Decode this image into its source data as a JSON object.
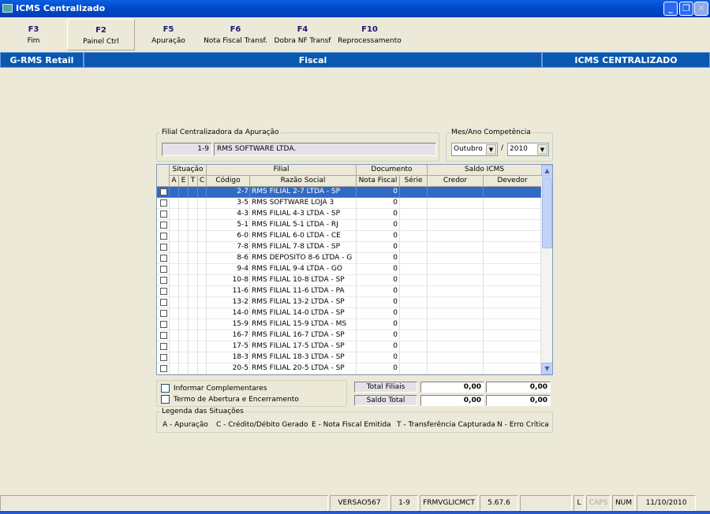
{
  "window": {
    "title": "ICMS Centralizado",
    "minimize": "_",
    "restore": "❐",
    "close": "✕"
  },
  "toolbar": [
    {
      "key": "F3",
      "label": "Fim"
    },
    {
      "key": "F2",
      "label": "Painel Ctrl"
    },
    {
      "key": "F5",
      "label": "Apuração"
    },
    {
      "key": "F6",
      "label": "Nota Fiscal Transf."
    },
    {
      "key": "F4",
      "label": "Dobra NF Transf"
    },
    {
      "key": "F10",
      "label": "Reprocessamento"
    }
  ],
  "header": {
    "left": "G-RMS Retail",
    "center": "Fiscal",
    "right": "ICMS CENTRALIZADO"
  },
  "filial": {
    "legend": "Filial Centralizadora da Apuração",
    "code": "1-9",
    "name": "RMS SOFTWARE LTDA."
  },
  "competencia": {
    "legend": "Mes/Ano Competência",
    "month": "Outubro",
    "sep": "/",
    "year": "2010"
  },
  "grid": {
    "groups": {
      "situacao": "Situação",
      "filial": "Filial",
      "documento": "Documento",
      "saldo": "Saldo ICMS"
    },
    "columns": {
      "a": "A",
      "e": "E",
      "t": "T",
      "c": "C",
      "codigo": "Código",
      "razao": "Razão Social",
      "nf": "Nota Fiscal",
      "serie": "Série",
      "credor": "Credor",
      "devedor": "Devedor"
    },
    "rows": [
      {
        "codigo": "2-7",
        "razao": "RMS FILIAL 2-7 LTDA - SP",
        "nf": "0"
      },
      {
        "codigo": "3-5",
        "razao": "RMS SOFTWARE LOJA 3",
        "nf": "0"
      },
      {
        "codigo": "4-3",
        "razao": "RMS FILIAL 4-3 LTDA - SP",
        "nf": "0"
      },
      {
        "codigo": "5-1",
        "razao": "RMS FILIAL 5-1 LTDA - RJ",
        "nf": "0"
      },
      {
        "codigo": "6-0",
        "razao": "RMS FILIAL 6-0 LTDA - CE",
        "nf": "0"
      },
      {
        "codigo": "7-8",
        "razao": "RMS FILIAL 7-8 LTDA - SP",
        "nf": "0"
      },
      {
        "codigo": "8-6",
        "razao": "RMS DEPOSITO 8-6 LTDA - G",
        "nf": "0"
      },
      {
        "codigo": "9-4",
        "razao": "RMS FILIAL 9-4 LTDA - GO",
        "nf": "0"
      },
      {
        "codigo": "10-8",
        "razao": "RMS FILIAL 10-8 LTDA - SP",
        "nf": "0"
      },
      {
        "codigo": "11-6",
        "razao": "RMS FILIAL 11-6 LTDA - PA",
        "nf": "0"
      },
      {
        "codigo": "13-2",
        "razao": "RMS FILIAL 13-2 LTDA - SP",
        "nf": "0"
      },
      {
        "codigo": "14-0",
        "razao": "RMS FILIAL 14-0 LTDA - SP",
        "nf": "0"
      },
      {
        "codigo": "15-9",
        "razao": "RMS FILIAL 15-9 LTDA - MS",
        "nf": "0"
      },
      {
        "codigo": "16-7",
        "razao": "RMS FILIAL 16-7 LTDA - SP",
        "nf": "0"
      },
      {
        "codigo": "17-5",
        "razao": "RMS FILIAL 17-5 LTDA - SP",
        "nf": "0"
      },
      {
        "codigo": "18-3",
        "razao": "RMS FILIAL 18-3 LTDA - SP",
        "nf": "0"
      },
      {
        "codigo": "20-5",
        "razao": "RMS FILIAL 20-5 LTDA - SP",
        "nf": "0"
      }
    ],
    "selected_row": 0
  },
  "options": {
    "complementares": "Informar Complementares",
    "termo": "Termo de Abertura e Encerramento"
  },
  "totals": {
    "total_filiais_label": "Total Filiais",
    "total_filiais_credor": "0,00",
    "total_filiais_devedor": "0,00",
    "saldo_total_label": "Saldo Total",
    "saldo_total_credor": "0,00",
    "saldo_total_devedor": "0,00"
  },
  "legenda": {
    "legend": "Legenda das Situações",
    "items": [
      "A - Apuração",
      "C - Crédito/Débito Gerado",
      "E - Nota Fiscal Emitida",
      "T - Transferência Capturada",
      "N - Erro Crítica"
    ]
  },
  "status": {
    "version": "VERSAO567",
    "filial": "1-9",
    "form": "FRMVGLICMCT",
    "build": "5.67.6",
    "l": "L",
    "caps": "CAPS",
    "num": "NUM",
    "date": "11/10/2010"
  }
}
